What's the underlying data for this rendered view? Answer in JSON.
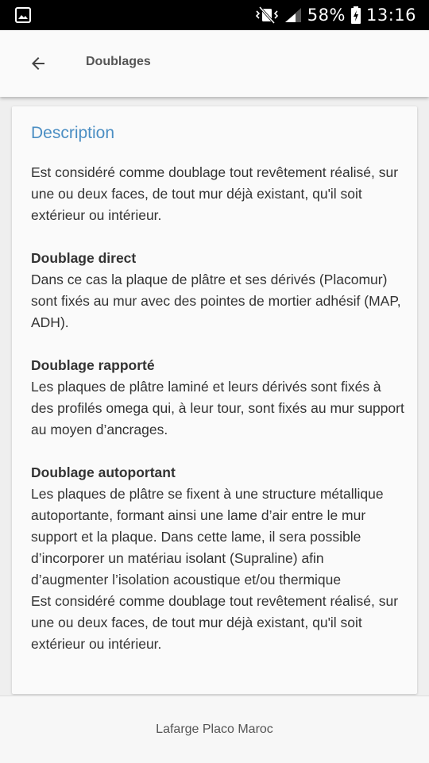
{
  "status_bar": {
    "battery": "58%",
    "time": "13:16",
    "icons": [
      "image-icon",
      "vibrate-icon",
      "signal-icon",
      "battery-charging-icon"
    ]
  },
  "app_bar": {
    "title": "Doublages",
    "back_icon": "arrow-back-icon"
  },
  "card": {
    "title": "Description",
    "intro": "Est considéré comme doublage tout revêtement réalisé, sur une ou deux faces, de tout mur déjà existant, qu'il soit extérieur ou intérieur.",
    "sections": [
      {
        "heading": "Doublage direct",
        "text": "Dans ce cas la plaque de plâtre et ses dérivés (Placomur) sont fixés au mur avec des pointes de mortier adhésif (MAP, ADH)."
      },
      {
        "heading": "Doublage rapporté",
        "text": "Les plaques de plâtre laminé et leurs dérivés sont fixés à des profilés omega qui, à leur tour, sont fixés au mur support au moyen d’ancrages."
      },
      {
        "heading": "Doublage autoportant",
        "text": "Les plaques de plâtre se fixent à une structure métallique autoportante, formant ainsi une lame d’air entre le mur support et la plaque. Dans cette lame, il sera possible d’incorporer un matériau isolant (Supraline) afin d’augmenter l’isolation acoustique et/ou thermique",
        "text2": "Est considéré comme doublage tout revêtement réalisé, sur une ou deux faces, de tout mur déjà existant, qu'il soit extérieur ou intérieur."
      }
    ]
  },
  "footer": {
    "text": "Lafarge Placo Maroc"
  },
  "colors": {
    "accent": "#4b8ec3",
    "status_bar": "#000000",
    "app_bar": "#fafafa",
    "background": "#efefef"
  }
}
